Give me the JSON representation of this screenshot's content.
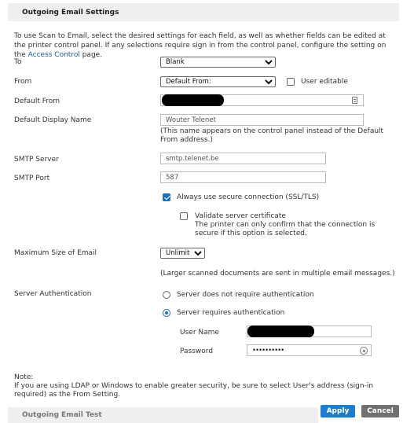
{
  "section": {
    "title": "Outgoing Email Settings",
    "intro_before_link": "To use Scan to Email, select the desired settings for each field, as well as whether fields can be edited at the printer control panel. If any selections require sign in from the control panel, configure the setting on the ",
    "intro_link": "Access Control",
    "intro_after_link": " page."
  },
  "fields": {
    "to": {
      "label": "To",
      "value": "Blank"
    },
    "from": {
      "label": "From",
      "value": "Default From:",
      "user_editable_label": "User editable",
      "user_editable": false
    },
    "default_from": {
      "label": "Default From",
      "icon": "contact-card-icon"
    },
    "display_name": {
      "label": "Default Display Name",
      "value": "Wouter Telenet",
      "help": "(This name appears on the control panel instead of the Default From address.)"
    },
    "smtp_server": {
      "label": "SMTP Server",
      "value": "smtp.telenet.be"
    },
    "smtp_port": {
      "label": "SMTP Port",
      "value": "587"
    },
    "secure": {
      "label": "Always use secure connection (SSL/TLS)",
      "checked": true
    },
    "validate": {
      "label": "Validate server certificate",
      "checked": false,
      "help": "The printer can only confirm that the connection is secure if this option is selected."
    },
    "max_size": {
      "label": "Maximum Size of Email",
      "value": "Unlimited",
      "help": "(Larger scanned documents are sent in multiple email messages.)"
    },
    "auth": {
      "label": "Server Authentication",
      "option_none": "Server does not require authentication",
      "option_required": "Server requires authentication",
      "selected": "required",
      "username_label": "User Name",
      "password_label": "Password",
      "password_value": "••••••••••"
    }
  },
  "note": {
    "heading": "Note:",
    "text": "If you are using LDAP or Windows to enable greater security, be sure to select User's address (sign-in required) as the From Setting."
  },
  "next_section": {
    "title": "Outgoing Email Test"
  },
  "buttons": {
    "apply": "Apply",
    "cancel": "Cancel"
  },
  "colors": {
    "accent": "#1d7ed0",
    "cancel": "#707070",
    "link": "#1a5fa8"
  }
}
